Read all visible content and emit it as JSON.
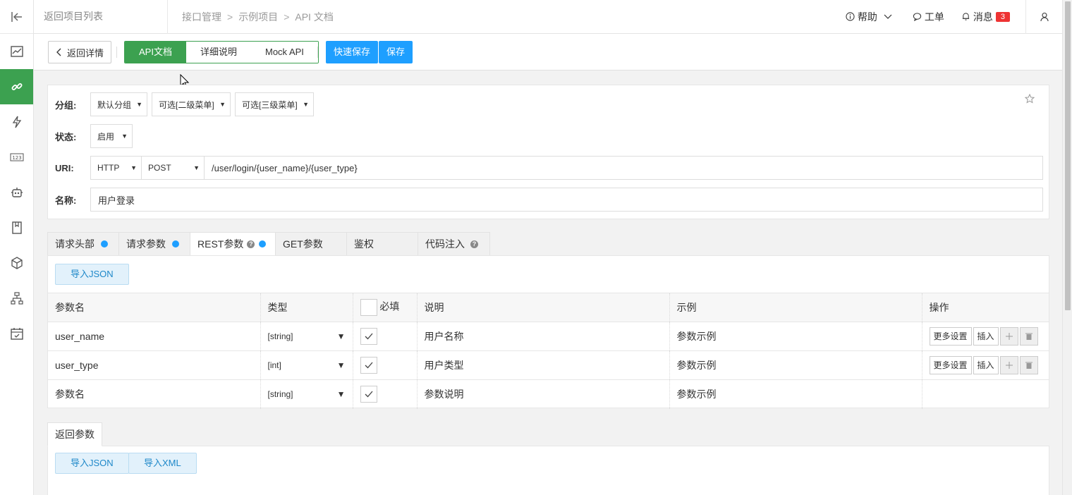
{
  "topbar": {
    "back_to_projects": "返回项目列表",
    "breadcrumb": [
      "接口管理",
      "示例项目",
      "API 文档"
    ],
    "help": "帮助",
    "ticket": "工单",
    "messages": "消息",
    "message_count": "3"
  },
  "toolbar": {
    "back_detail": "返回详情",
    "tabs": [
      "API文档",
      "详细说明",
      "Mock API"
    ],
    "quick_save": "快速保存",
    "save": "保存"
  },
  "form": {
    "group_label": "分组:",
    "group_default": "默认分组",
    "group_level2": "可选[二级菜单]",
    "group_level3": "可选[三级菜单]",
    "status_label": "状态:",
    "status_value": "启用",
    "uri_label": "URI:",
    "protocol": "HTTP",
    "method": "POST",
    "uri_value": "/user/login/{user_name}/{user_type}",
    "name_label": "名称:",
    "name_value": "用户登录"
  },
  "param_tabs": [
    "请求头部",
    "请求参数",
    "REST参数",
    "GET参数",
    "鉴权",
    "代码注入"
  ],
  "import_json": "导入JSON",
  "import_xml": "导入XML",
  "table": {
    "headers": [
      "参数名",
      "类型",
      "必填",
      "说明",
      "示例",
      "操作"
    ],
    "rows": [
      {
        "name": "user_name",
        "type": "[string]",
        "desc": "用户名称",
        "example": "参数示例"
      },
      {
        "name": "user_type",
        "type": "[int]",
        "desc": "用户类型",
        "example": "参数示例"
      }
    ],
    "new_row": {
      "name": "参数名",
      "type": "[string]",
      "desc": "参数说明",
      "example": "参数示例"
    },
    "more_settings": "更多设置",
    "insert": "插入"
  },
  "response": {
    "tab": "返回参数"
  }
}
